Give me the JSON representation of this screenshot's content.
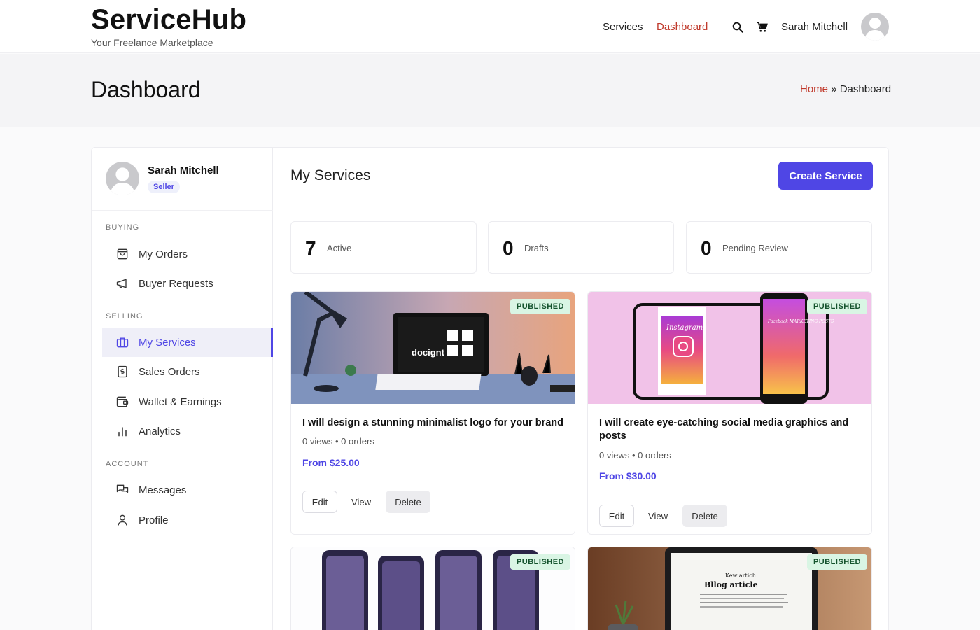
{
  "header": {
    "brand": "ServiceHub",
    "tagline": "Your Freelance Marketplace",
    "nav": {
      "services": "Services",
      "dashboard": "Dashboard"
    },
    "user_name": "Sarah Mitchell",
    "icons": [
      "search-icon",
      "cart-icon",
      "avatar"
    ]
  },
  "page": {
    "title": "Dashboard",
    "breadcrumb": {
      "home": "Home",
      "separator": "»",
      "current": "Dashboard"
    }
  },
  "sidebar": {
    "user": {
      "name": "Sarah Mitchell",
      "role": "Seller"
    },
    "sections": {
      "buying": "BUYING",
      "selling": "SELLING",
      "account": "ACCOUNT"
    },
    "items": {
      "my_orders": "My Orders",
      "buyer_requests": "Buyer Requests",
      "my_services": "My Services",
      "sales_orders": "Sales Orders",
      "wallet": "Wallet & Earnings",
      "analytics": "Analytics",
      "messages": "Messages",
      "profile": "Profile"
    },
    "active_item": "my_services"
  },
  "main": {
    "title": "My Services",
    "create_button": "Create Service",
    "stats": [
      {
        "value": "7",
        "label": "Active"
      },
      {
        "value": "0",
        "label": "Drafts"
      },
      {
        "value": "0",
        "label": "Pending Review"
      }
    ],
    "services": [
      {
        "title": "I will design a stunning minimalist logo for your brand",
        "meta": "0 views • 0 orders",
        "price": "From $25.00",
        "status": "PUBLISHED",
        "image_text": "docignt"
      },
      {
        "title": "I will create eye-catching social media graphics and posts",
        "meta": "0 views • 0 orders",
        "price": "From $30.00",
        "status": "PUBLISHED",
        "image_text": {
          "left": "Instagram",
          "right": "Facebook MARKETING POSTS"
        }
      },
      {
        "title": "",
        "status": "PUBLISHED"
      },
      {
        "title": "",
        "status": "PUBLISHED",
        "image_text": {
          "heading": "Kew artich",
          "subheading": "Bllog article"
        }
      }
    ],
    "actions": {
      "edit": "Edit",
      "view": "View",
      "delete": "Delete"
    }
  },
  "colors": {
    "accent": "#4f46e5",
    "nav_active": "#c0392b",
    "badge_bg": "#d9f5e4"
  }
}
